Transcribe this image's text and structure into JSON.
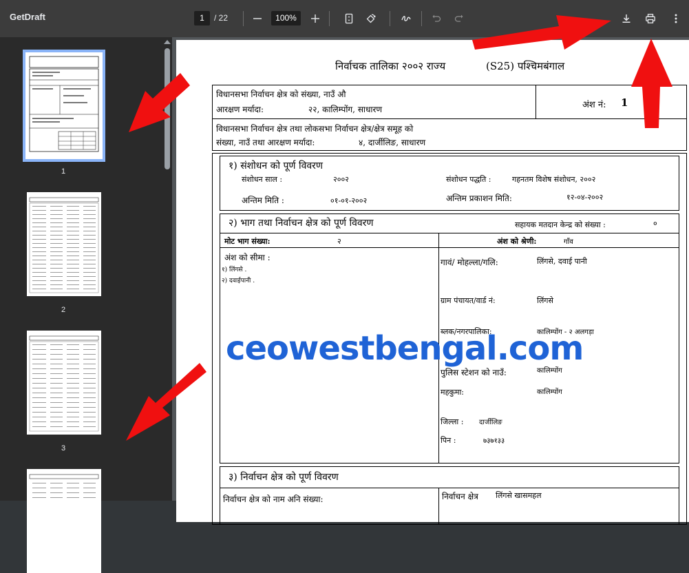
{
  "toolbar": {
    "title": "GetDraft",
    "page_current": "1",
    "page_total": "/ 22",
    "zoom": "100%",
    "icons": [
      "minus-icon",
      "plus-icon",
      "fit-page-icon",
      "rotate-icon",
      "annotate-icon",
      "undo-icon",
      "redo-icon",
      "download-icon",
      "print-icon",
      "more-vert-icon"
    ]
  },
  "sidebar": {
    "thumbnails": [
      {
        "label": "1",
        "selected": true
      },
      {
        "label": "2",
        "selected": false
      },
      {
        "label": "3",
        "selected": false
      }
    ]
  },
  "document": {
    "heading_left": "निर्वाचक तालिका २००२ राज्य",
    "heading_right": "(S25) पश्चिमबंगाल",
    "r1_line1": "विधानसभा निर्वाचन क्षेत्र को  संख्या, नाउँ औ",
    "r1_line2_label": "आरक्षण मर्यादा:",
    "r1_line2_value": "२२,  कालिम्पोंग,  साधारण",
    "part_label": "अंश नं:",
    "part_value": "1",
    "r2_line1": "विधानसभा निर्वाचन क्षेत्र तथा लोकसभा निर्वाचन क्षेत्र/क्षेत्र समूह को",
    "r2_line2_label": "संख्या, नाउँ तथा आरक्षण मर्यादा:",
    "r2_line2_value": "४,  दार्जीलिङ,  साधारण",
    "s1_title": "१) संशोधन को पूर्ण विवरण",
    "s1_year_label": "संशोधन साल :",
    "s1_year_value": "२००२",
    "s1_method_label": "संशोधन पद्धति :",
    "s1_method_value": "गहनतम विशेष संशोधन, २००२",
    "s1_date_label": "अन्तिम मिति :",
    "s1_date_value": "०१-०१-२००२",
    "s1_pub_label": "अन्तिम प्रकाशन मिति:",
    "s1_pub_value": "१२-०४-२००२",
    "s2_title": "२) भाग तथा निर्वाचन क्षेत्र को पूर्ण विवरण",
    "s2_aux_label": "सहायक मतदान केन्द्र को संख्या :",
    "s2_aux_value": "०",
    "s2_total_label": "मोट भाग संख्या:",
    "s2_total_value": "२",
    "s2_category_label": "अंश को श्रेणी:",
    "s2_category_value": "गाँव",
    "s2_boundary_label": "अंश को सीमा :",
    "s2_boundary_1": "१) लिंगसे .",
    "s2_boundary_2": "२) दवाईपानी .",
    "s2_village_label": "गावं/ मोहल्ला/गलि:",
    "s2_village_value": "लिंगसे, दवाई पानी",
    "s2_gp_label": "ग्राम पंचायत/वार्ड नं:",
    "s2_gp_value": "लिंगसे",
    "s2_block_label": "ब्लक/नगरपालिका:",
    "s2_block_value": "कालिम्पोंग - २   अलगड़ा",
    "s2_police_label": "पुलिस स्टेशन को नाउँ:",
    "s2_police_value": "कालिम्पोंग",
    "s2_subdiv_label": "महकुमा:",
    "s2_subdiv_value": "कालिम्पोंग",
    "s2_district_label": "जिल्ला :",
    "s2_district_value": "दार्जीलिङ",
    "s2_pin_label": "पिन    :",
    "s2_pin_value": "७३७१३३",
    "s3_title": "३) निर्वाचन क्षेत्र को पूर्ण विवरण",
    "s3_left_label": "निर्वाचन क्षेत्र को नाम अनि संख्या:",
    "s3_right_label": "निर्वाचन क्षेत्र",
    "s3_right_value": "लिंगसे खासमहल"
  },
  "watermark": "ceowestbengal.com",
  "colors": {
    "toolbar": "#3c3c3c",
    "sidebar": "#2a2a2a",
    "viewer_bg": "#525659",
    "selected": "#8ab4f8",
    "watermark": "#1f63d6",
    "arrow": "#f01010"
  }
}
